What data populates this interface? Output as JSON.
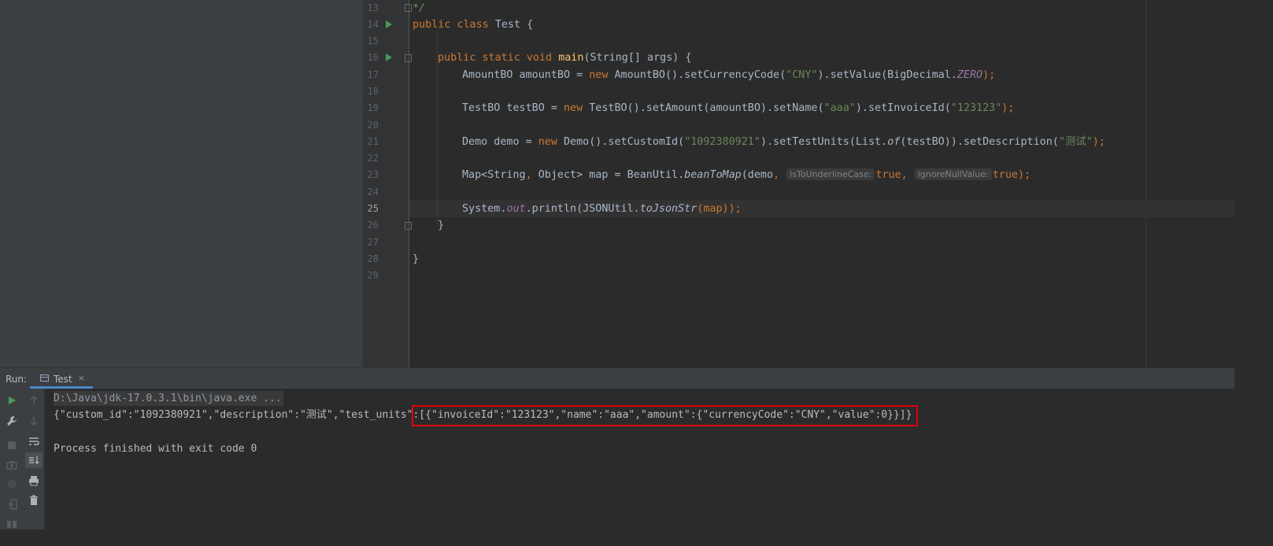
{
  "editor": {
    "line_numbers": [
      "13",
      "14",
      "15",
      "16",
      "17",
      "18",
      "19",
      "20",
      "21",
      "22",
      "23",
      "24",
      "25",
      "26",
      "27",
      "28",
      "29"
    ],
    "lines": {
      "l13": {
        "comment": "*/"
      },
      "l14": {
        "kw1": "public",
        "kw2": "class",
        "name": "Test {"
      },
      "l16": {
        "kw1": "public",
        "kw2": "static",
        "kw3": "void",
        "method": "main",
        "params": "(String[] args) {"
      },
      "l17": {
        "a": "AmountBO amountBO = ",
        "new": "new",
        "b": " AmountBO().setCurrencyCode(",
        "s1": "\"CNY\"",
        "c": ").setValue(BigDecimal.",
        "static": "ZERO",
        "d": ");"
      },
      "l19": {
        "a": "TestBO testBO = ",
        "new": "new",
        "b": " TestBO().setAmount(amountBO).setName(",
        "s1": "\"aaa\"",
        "c": ").setInvoiceId(",
        "s2": "\"123123\"",
        "d": ");"
      },
      "l21": {
        "a": "Demo demo = ",
        "new": "new",
        "b": " Demo().setCustomId(",
        "s1": "\"1092380921\"",
        "c": ").setTestUnits(List.",
        "of": "of",
        "d": "(testBO)).setDescription(",
        "s2": "\"测试\"",
        "e": ");"
      },
      "l23": {
        "a": "Map<String",
        "comma1": ",",
        "b": " Object> map = BeanUtil.",
        "method": "beanToMap",
        "c": "(demo",
        "comma2": ",",
        "hint1": "isToUnderlineCase:",
        "t1": "true",
        "comma3": ",",
        "hint2": "ignoreNullValue:",
        "t2": "true",
        "d": ");"
      },
      "l25": {
        "a": "System.",
        "out": "out",
        "b": ".println(JSONUtil.",
        "method": "toJsonStr",
        "c": "(map));"
      },
      "l26": {
        "brace": "}"
      },
      "l28": {
        "brace": "}"
      }
    }
  },
  "run_panel": {
    "label": "Run:",
    "tab_label": "Test",
    "tab_close": "×",
    "command": "D:\\Java\\jdk-17.0.3.1\\bin\\java.exe ...",
    "output_prefix": "{\"custom_id\":\"1092380921\",\"description\":\"测试\",\"test_units\":",
    "output_highlighted": "[{\"invoiceId\":\"123123\",\"name\":\"aaa\",\"amount\":{\"currencyCode\":\"CNY\",\"value\":0}}]}",
    "exit_message": "Process finished with exit code 0"
  },
  "colors": {
    "keyword": "#cc7832",
    "string": "#6a8759",
    "method": "#ffc66d",
    "static_field": "#9876aa",
    "highlight_box": "#e0000a",
    "run_green": "#499c54"
  },
  "icons": [
    "run-icon",
    "wrench-icon",
    "stop-icon",
    "camera-icon",
    "settings-icon",
    "login-icon",
    "layout-icon",
    "up-arrow-icon",
    "down-arrow-icon",
    "soft-wrap-icon",
    "scroll-to-end-icon",
    "print-icon",
    "trash-icon"
  ]
}
